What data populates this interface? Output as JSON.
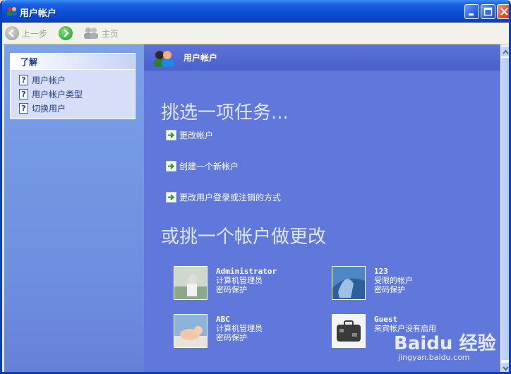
{
  "window": {
    "title": "用户帐户"
  },
  "toolbar": {
    "back_label": "上一步",
    "home_label": "主页"
  },
  "left_pane": {
    "section_title": "了解",
    "items": [
      {
        "label": "用户帐户",
        "icon": "help-icon"
      },
      {
        "label": "用户帐户类型",
        "icon": "help-icon"
      },
      {
        "label": "切换用户",
        "icon": "help-icon"
      }
    ]
  },
  "main": {
    "header_title": "用户帐户",
    "heading_tasks": "挑选一项任务...",
    "tasks": [
      {
        "label": "更改帐户"
      },
      {
        "label": "创建一个新帐户"
      },
      {
        "label": "更改用户登录或注销的方式"
      }
    ],
    "heading_accounts": "或挑一个帐户做更改",
    "accounts": [
      {
        "name": "Administrator",
        "line1": "计算机管理员",
        "line2": "密码保护"
      },
      {
        "name": "123",
        "line1": "受限的帐户",
        "line2": "密码保护"
      },
      {
        "name": "ABC",
        "line1": "计算机管理员",
        "line2": "密码保护"
      },
      {
        "name": "Guest",
        "line1": "来宾帐户没有启用",
        "line2": ""
      }
    ]
  },
  "watermark": {
    "text": "Baidu 经验",
    "sub": "jingyan.baidu.com"
  },
  "colors": {
    "title_bar": "#0a4fd6",
    "main_bg": "#6078dc",
    "left_bg": "#7ba2e7",
    "link_text": "#1e3a8a"
  }
}
